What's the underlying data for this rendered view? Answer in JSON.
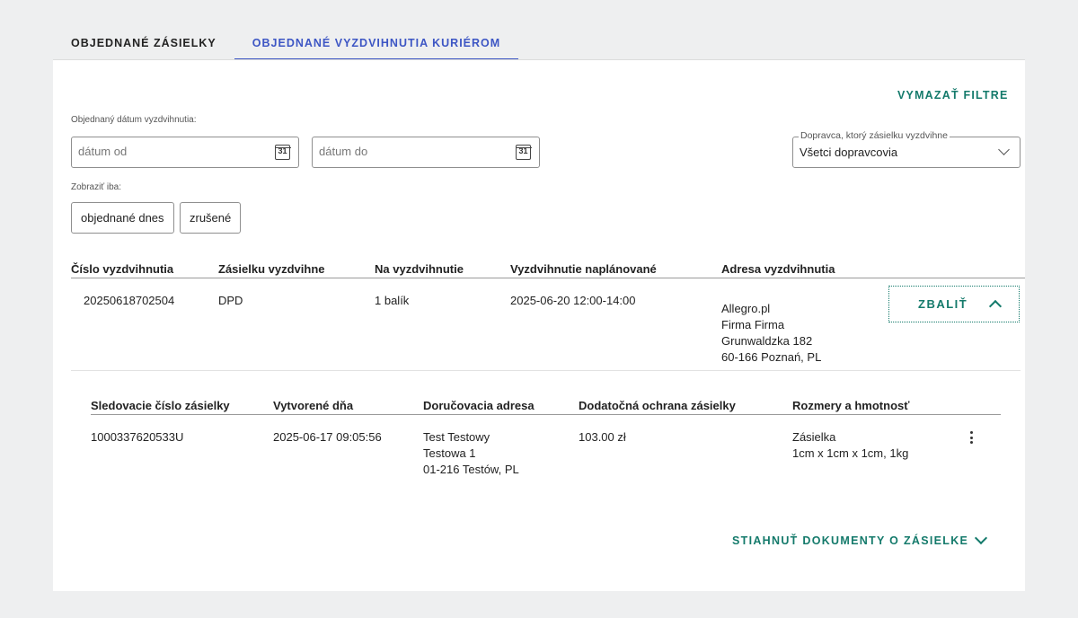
{
  "tabs": [
    {
      "label": "OBJEDNANÉ ZÁSIELKY",
      "active": false
    },
    {
      "label": "OBJEDNANÉ VYZDVIHNUTIA KURIÉROM",
      "active": true
    }
  ],
  "filters": {
    "clear_label": "VYMAZAŤ FILTRE",
    "date_label": "Objednaný dátum vyzdvihnutia:",
    "date_from_placeholder": "dátum od",
    "date_to_placeholder": "dátum do",
    "calendar_day": "31",
    "carrier_label": "Dopravca, ktorý zásielku vyzdvihne",
    "carrier_value": "Všetci dopravcovia",
    "show_only_label": "Zobraziť iba:",
    "chips": [
      "objednané dnes",
      "zrušené"
    ]
  },
  "pickups_table": {
    "headers": [
      "Číslo vyzdvihnutia",
      "Zásielku vyzdvihne",
      "Na vyzdvihnutie",
      "Vyzdvihnutie naplánované",
      "Adresa vyzdvihnutia"
    ],
    "row": {
      "number": "20250618702504",
      "carrier": "DPD",
      "count": "1 balík",
      "scheduled": "2025-06-20 12:00-14:00",
      "address": [
        "Allegro.pl",
        "Firma Firma",
        "Grunwaldzka 182",
        "60-166 Poznań, PL"
      ],
      "collapse_label": "ZBALIŤ"
    }
  },
  "shipments_table": {
    "headers": [
      "Sledovacie číslo zásielky",
      "Vytvorené dňa",
      "Doručovacia adresa",
      "Dodatočná ochrana zásielky",
      "Rozmery a hmotnosť"
    ],
    "row": {
      "tracking": "1000337620533U",
      "created": "2025-06-17 09:05:56",
      "address": [
        "Test Testowy",
        "Testowa 1",
        "01-216 Testów, PL"
      ],
      "protection": "103.00 zł",
      "dimensions": [
        "Zásielka",
        "1cm x 1cm x 1cm, 1kg"
      ]
    },
    "download_label": "STIAHNUŤ DOKUMENTY O ZÁSIELKE"
  }
}
